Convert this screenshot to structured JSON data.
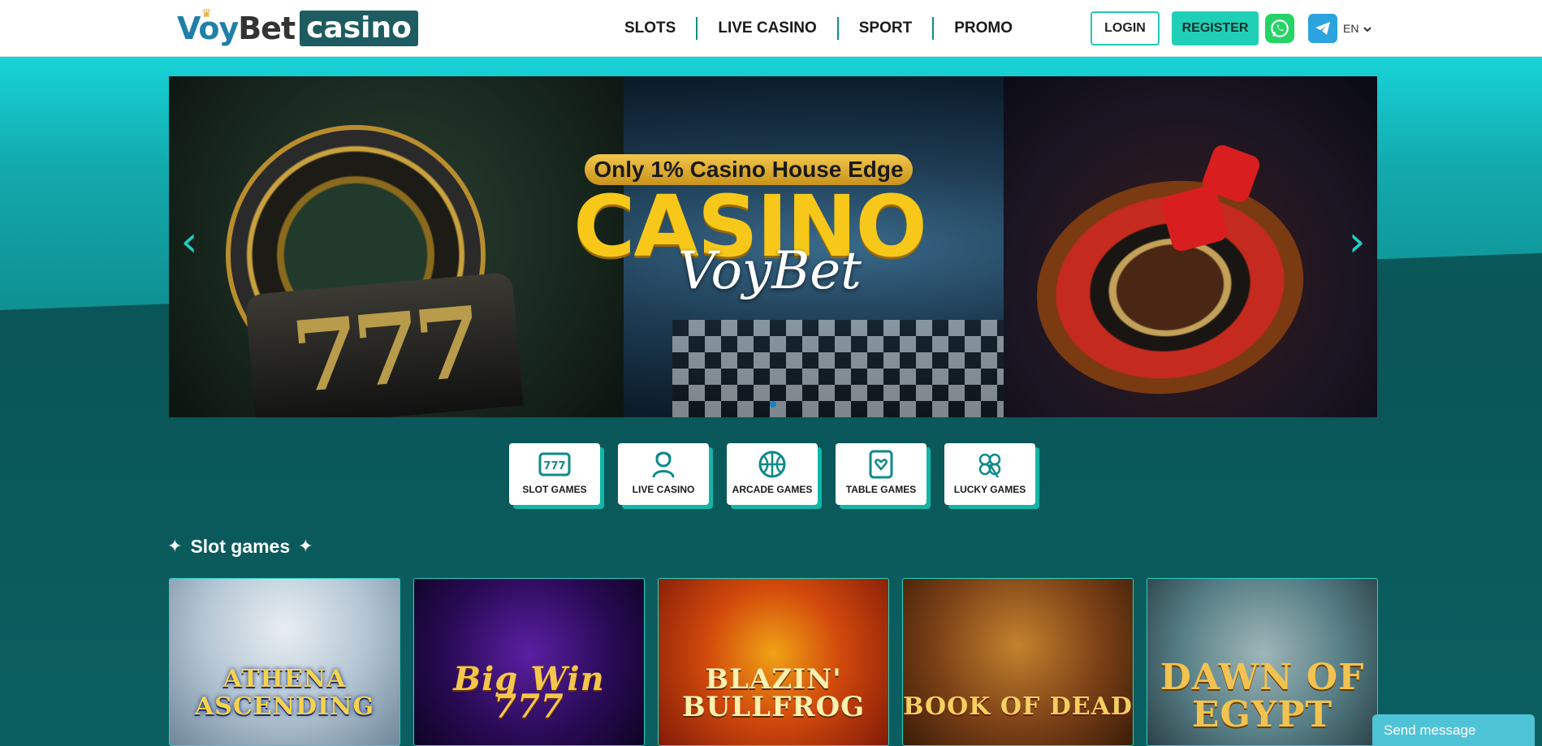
{
  "header": {
    "logo": {
      "part1": "Voy",
      "part2": "Bet",
      "part3": "casino"
    },
    "nav": [
      {
        "label": "SLOTS"
      },
      {
        "label": "LIVE CASINO"
      },
      {
        "label": "SPORT"
      },
      {
        "label": "PROMO"
      }
    ],
    "login_label": "LOGIN",
    "register_label": "REGISTER",
    "whatsapp_icon": "whatsapp-icon",
    "telegram_icon": "telegram-icon",
    "language": "EN"
  },
  "banner": {
    "tag": "Only 1% Casino House Edge",
    "headline": "CASINO",
    "subheadline": "VoyBet"
  },
  "categories": [
    {
      "label": "SLOT GAMES",
      "icon": "slot-777-icon"
    },
    {
      "label": "LIVE CASINO",
      "icon": "dealer-icon"
    },
    {
      "label": "ARCADE GAMES",
      "icon": "basketball-icon"
    },
    {
      "label": "TABLE GAMES",
      "icon": "card-heart-icon"
    },
    {
      "label": "LUCKY GAMES",
      "icon": "clover-icon"
    }
  ],
  "section": {
    "title": "Slot games"
  },
  "games": [
    {
      "title": "ATHENA ASCENDING"
    },
    {
      "title": "Big Win 777"
    },
    {
      "title": "BLAZIN' BULLFROG"
    },
    {
      "title": "BOOK OF DEAD"
    },
    {
      "title": "DAWN OF EGYPT"
    }
  ],
  "chat": {
    "label": "Send message"
  },
  "colors": {
    "accent": "#1fd0b6",
    "background": "#0b5f60",
    "nav_divider": "#0c8f86"
  }
}
